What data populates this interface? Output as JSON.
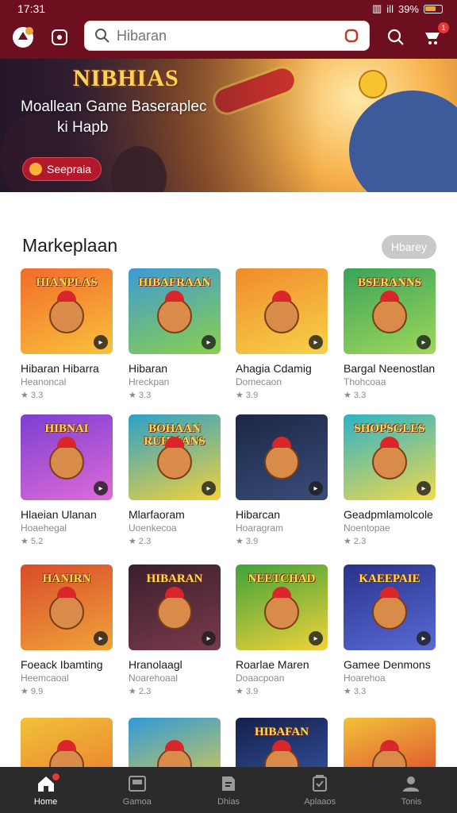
{
  "status_bar": {
    "time": "17:31",
    "signal_text": "ill",
    "battery_text": "39%"
  },
  "header": {
    "search_placeholder": "Hibaran",
    "cart_badge": "1"
  },
  "hero": {
    "logo_text": "NIBHIAS",
    "title_line1": "Moallean Game Baseraplec",
    "title_line2": "ki Hapb",
    "button_label": "Seepraia"
  },
  "section": {
    "title": "Markeplaan",
    "see_all": "Hbarey"
  },
  "games": [
    {
      "banner": "HIANPLAS",
      "title": "Hibaran Hibarra",
      "subtitle": "Heanoncal",
      "rating": "★ 3.3"
    },
    {
      "banner": "HIBAFRAAN",
      "title": "Hibaran",
      "subtitle": "Hreckpan",
      "rating": "★ 3.3"
    },
    {
      "banner": "",
      "title": "Ahagia Cdamig",
      "subtitle": "Domecaon",
      "rating": "★ 3.9"
    },
    {
      "banner": "BSERANNS",
      "title": "Bargal Neenostlan",
      "subtitle": "Thohcoaa",
      "rating": "★ 3.3"
    },
    {
      "banner": "HIBNAI",
      "title": "Hlaeian Ulanan",
      "subtitle": "Hoaehegal",
      "rating": "★ 5.2"
    },
    {
      "banner": "BOHAAN RUHMANS",
      "title": "Mlarfaoram",
      "subtitle": "Uoenkecoa",
      "rating": "★ 2.3"
    },
    {
      "banner": "",
      "title": "Hibarcan",
      "subtitle": "Hoaragram",
      "rating": "★ 3.9"
    },
    {
      "banner": "SHOPSGLES",
      "title": "Geadpmlamolcole",
      "subtitle": "Noentopae",
      "rating": "★ 2.3"
    },
    {
      "banner": "HANIRN",
      "title": "Foeack Ibamting",
      "subtitle": "Heemcaoal",
      "rating": "★ 9.9"
    },
    {
      "banner": "HIBARAN",
      "title": "Hranolaagl",
      "subtitle": "Noarehoaal",
      "rating": "★ 2.3"
    },
    {
      "banner": "NEETCHAD",
      "title": "Roarlae Maren",
      "subtitle": "Doaacpoan",
      "rating": "★ 3.9"
    },
    {
      "banner": "KAEEPAIE",
      "title": "Gamee Denmons",
      "subtitle": "Hoarehoa",
      "rating": "★ 3.3"
    },
    {
      "banner": "",
      "title": "",
      "subtitle": "",
      "rating": ""
    },
    {
      "banner": "",
      "title": "",
      "subtitle": "",
      "rating": ""
    },
    {
      "banner": "HIBAFAN",
      "title": "",
      "subtitle": "",
      "rating": ""
    },
    {
      "banner": "",
      "title": "",
      "subtitle": "",
      "rating": ""
    }
  ],
  "bottom_nav": [
    {
      "label": "Home",
      "icon": "home-icon",
      "active": true
    },
    {
      "label": "Gamoa",
      "icon": "games-icon",
      "active": false
    },
    {
      "label": "Dhias",
      "icon": "deals-icon",
      "active": false
    },
    {
      "label": "Aplaaos",
      "icon": "apps-icon",
      "active": false
    },
    {
      "label": "Tonis",
      "icon": "profile-icon",
      "active": false
    }
  ],
  "colors": {
    "brand": "#6e0f1f",
    "accent": "#b3192c",
    "nav_bg": "#2b2b2b"
  }
}
